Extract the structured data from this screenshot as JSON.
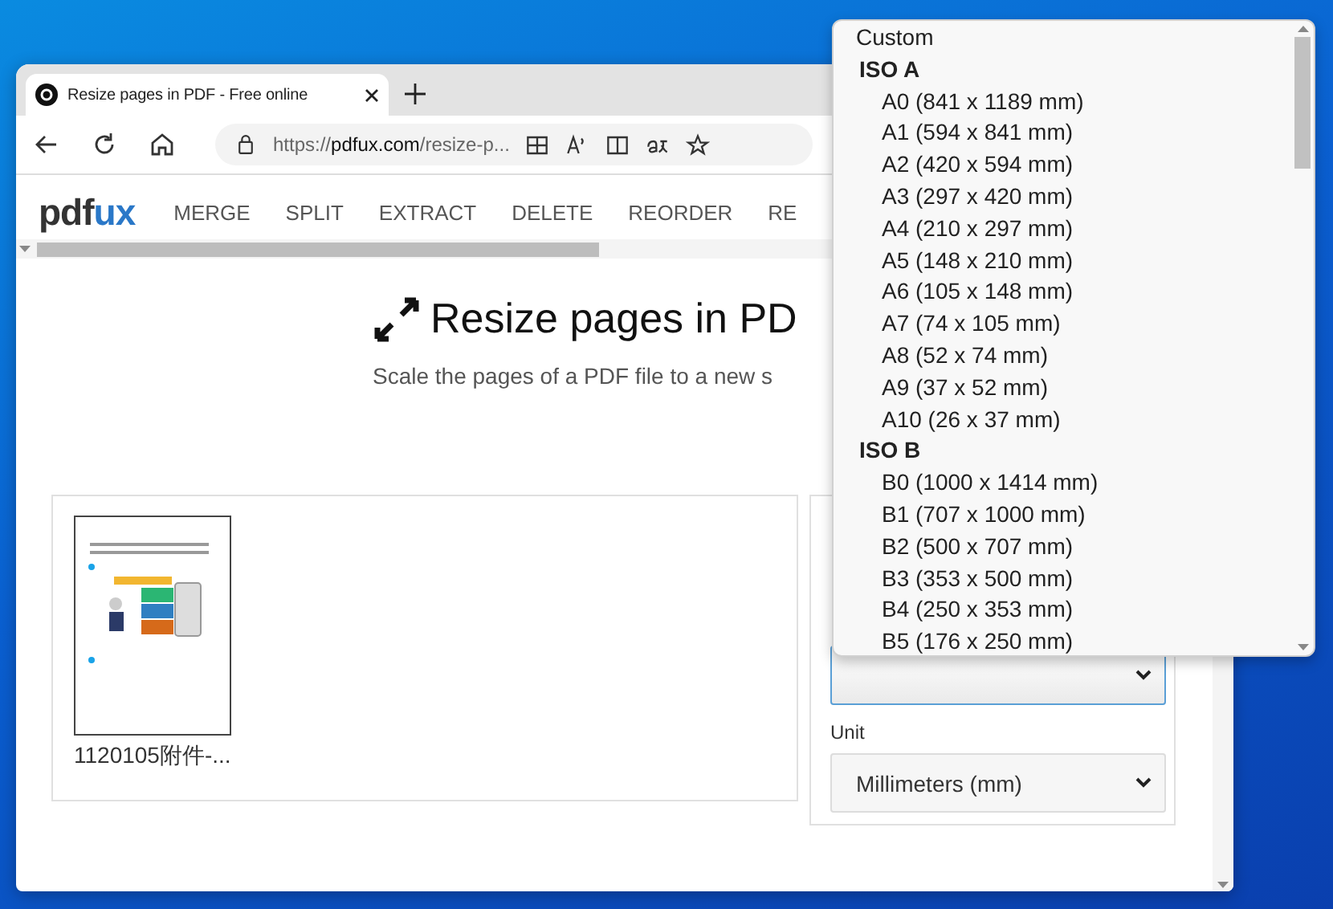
{
  "browser": {
    "tab": {
      "title": "Resize pages in PDF - Free online"
    },
    "address": {
      "scheme": "https://",
      "domain": "pdfux.com",
      "path": "/resize-p..."
    }
  },
  "site": {
    "logo": {
      "first": "pdf",
      "second": "ux"
    },
    "nav": [
      "MERGE",
      "SPLIT",
      "EXTRACT",
      "DELETE",
      "REORDER",
      "RE"
    ]
  },
  "page": {
    "title": "Resize pages in PD",
    "subtitle": "Scale the pages of a PDF file to a new s"
  },
  "file": {
    "name": "1120105附件-..."
  },
  "settings": {
    "size_select": {
      "focused": true
    },
    "unit_label": "Unit",
    "unit_select": {
      "value": "Millimeters (mm)"
    }
  },
  "dropdown": [
    {
      "kind": "option",
      "label": "Custom"
    },
    {
      "kind": "group",
      "label": "ISO A"
    },
    {
      "kind": "option",
      "label": "A0 (841 x 1189 mm)"
    },
    {
      "kind": "option",
      "label": "A1 (594 x 841 mm)"
    },
    {
      "kind": "option",
      "label": "A2 (420 x 594 mm)"
    },
    {
      "kind": "option",
      "label": "A3 (297 x 420 mm)"
    },
    {
      "kind": "option",
      "label": "A4 (210 x 297 mm)"
    },
    {
      "kind": "option",
      "label": "A5 (148 x 210 mm)"
    },
    {
      "kind": "option",
      "label": "A6 (105 x 148 mm)"
    },
    {
      "kind": "option",
      "label": "A7 (74 x 105 mm)"
    },
    {
      "kind": "option",
      "label": "A8 (52 x 74 mm)"
    },
    {
      "kind": "option",
      "label": "A9 (37 x 52 mm)"
    },
    {
      "kind": "option",
      "label": "A10 (26 x 37 mm)"
    },
    {
      "kind": "group",
      "label": "ISO B"
    },
    {
      "kind": "option",
      "label": "B0 (1000 x 1414 mm)"
    },
    {
      "kind": "option",
      "label": "B1 (707 x 1000 mm)"
    },
    {
      "kind": "option",
      "label": "B2 (500 x 707 mm)"
    },
    {
      "kind": "option",
      "label": "B3 (353 x 500 mm)"
    },
    {
      "kind": "option",
      "label": "B4 (250 x 353 mm)"
    },
    {
      "kind": "option",
      "label": "B5 (176 x 250 mm)"
    }
  ]
}
